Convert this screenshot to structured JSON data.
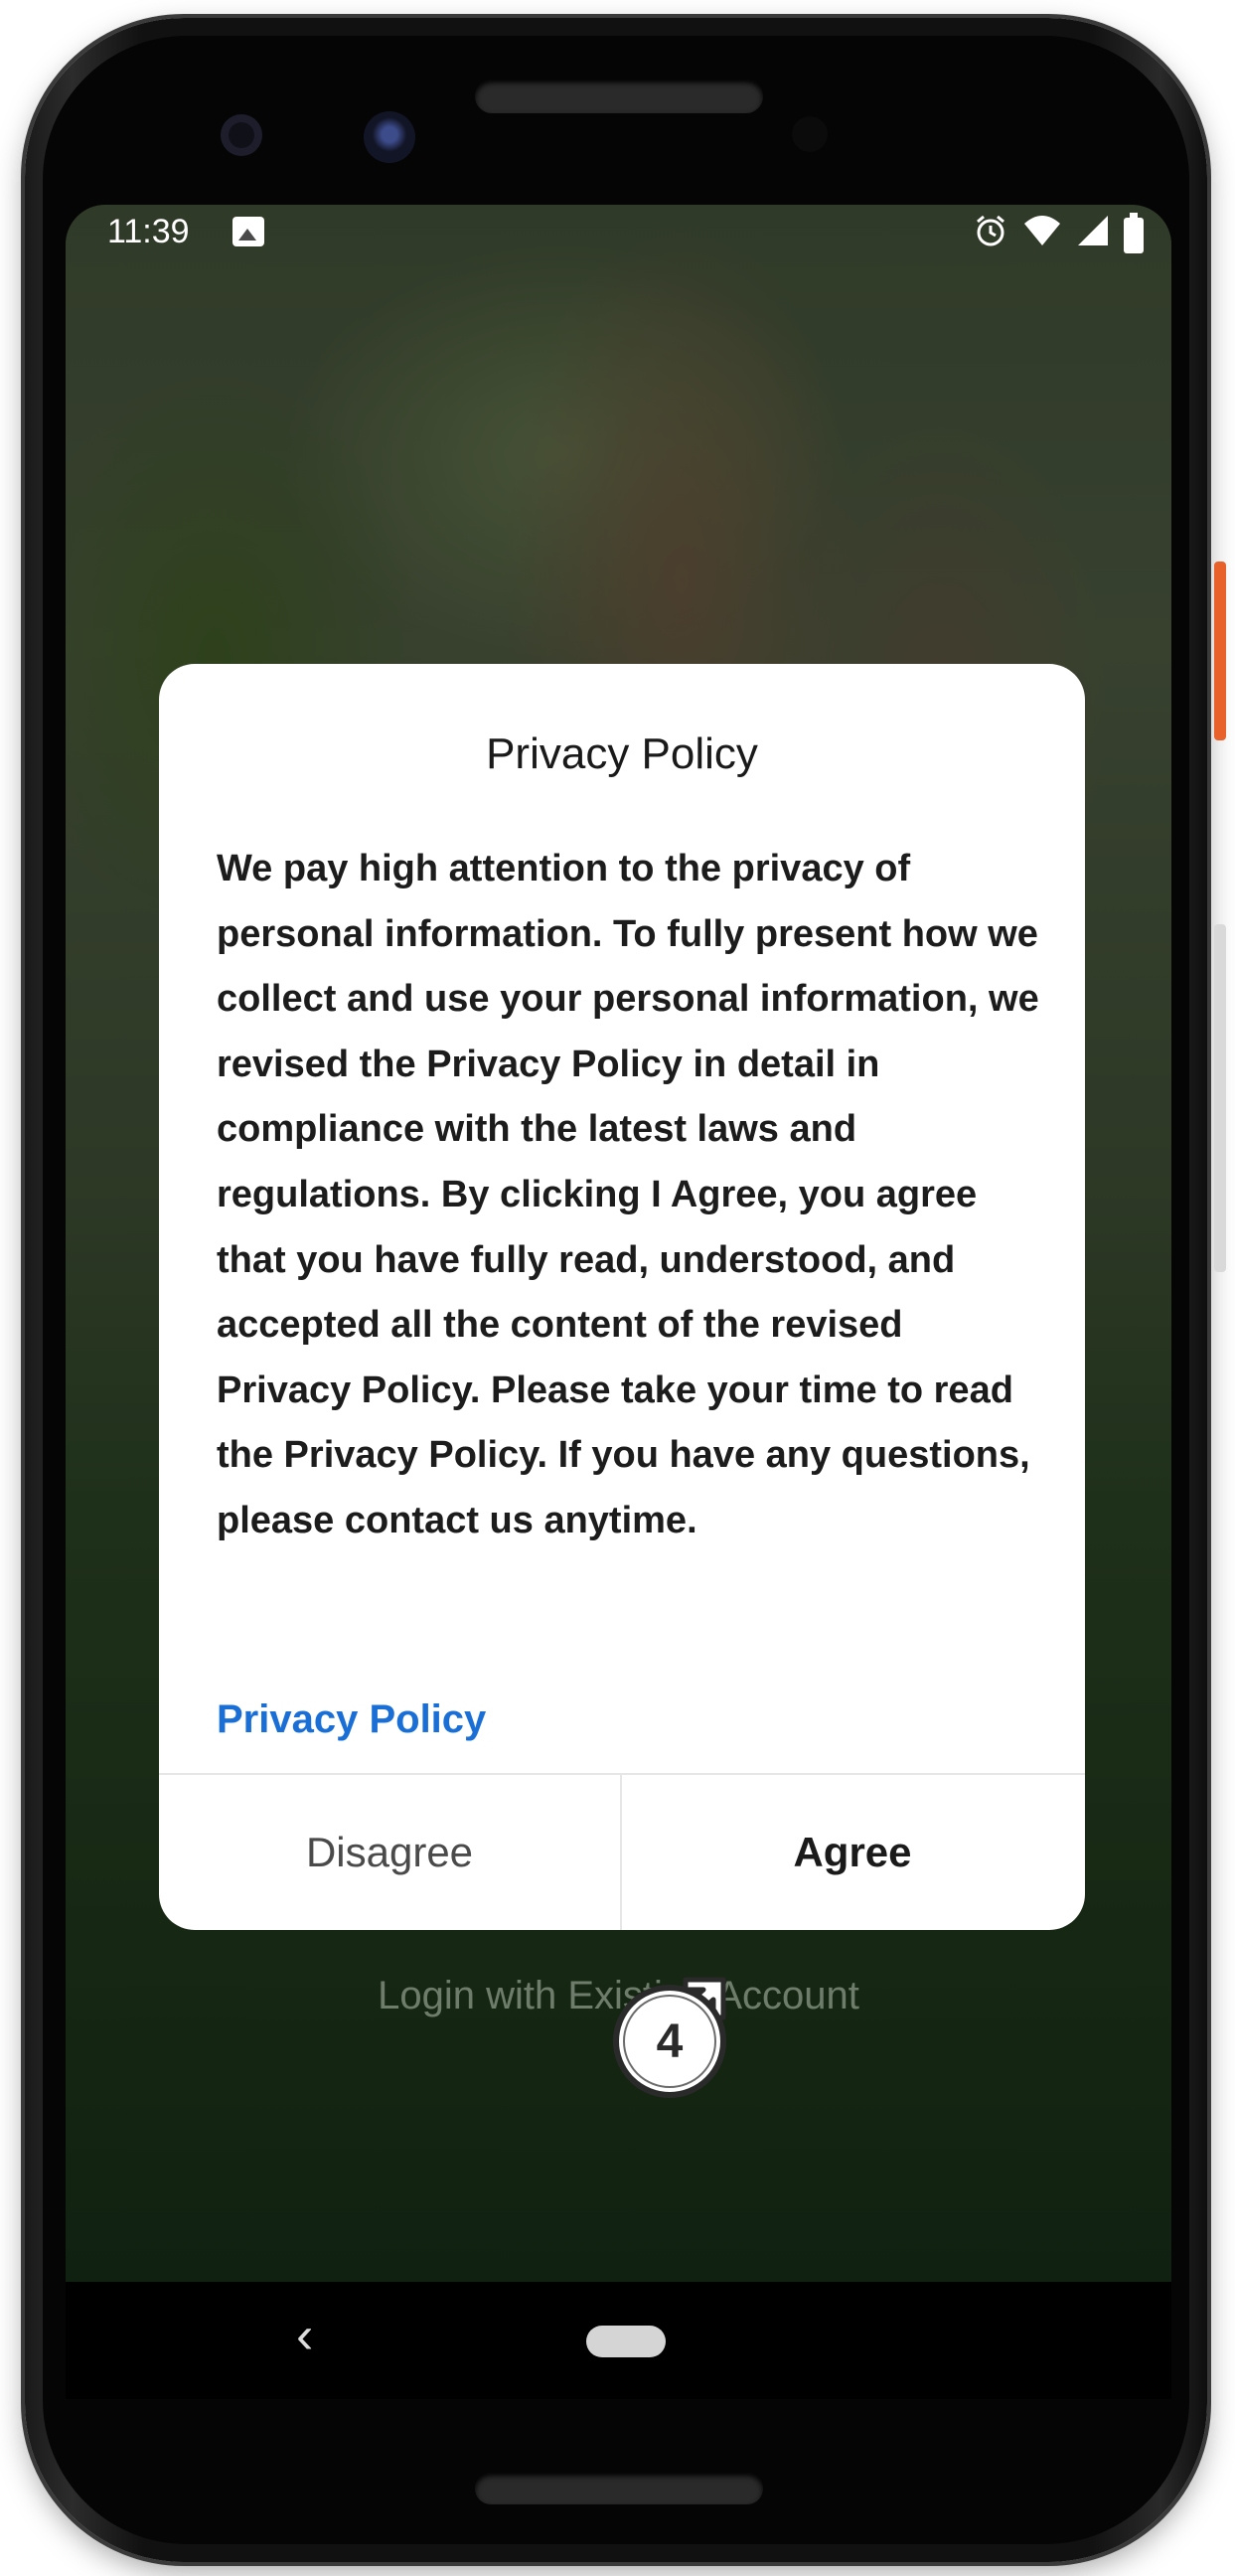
{
  "status_bar": {
    "time": "11:39",
    "icons": [
      "image-icon",
      "alarm-icon",
      "wifi-icon",
      "signal-icon",
      "battery-icon"
    ]
  },
  "background": {
    "login_text": "Login with Existing Account"
  },
  "dialog": {
    "title": "Privacy Policy",
    "body": "We pay high attention to the privacy of personal information. To fully present how we collect and use your personal information, we revised the Privacy Policy in detail in compliance with the latest laws and regulations. By clicking I Agree, you agree that you have fully read, understood, and accepted all the content of the revised Privacy Policy. Please take your time to read the Privacy Policy. If you have any questions, please contact us anytime.",
    "link_label": "Privacy Policy",
    "disagree_label": "Disagree",
    "agree_label": "Agree"
  },
  "nav_bar": {
    "back_glyph": "‹"
  },
  "annotation": {
    "step_number": "4"
  },
  "colors": {
    "link": "#1a6fd6",
    "dialog_bg": "#ffffff",
    "accent_button": "#e8602a"
  }
}
